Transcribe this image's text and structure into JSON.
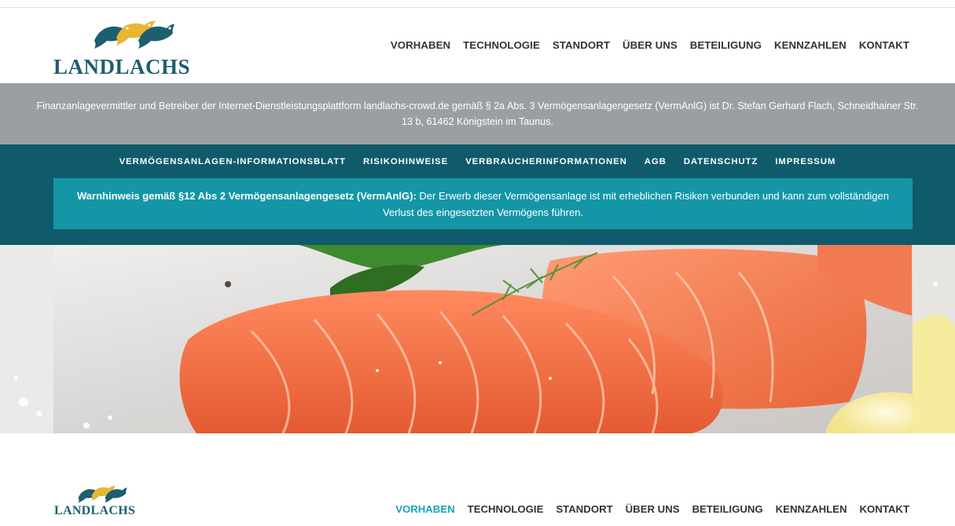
{
  "brand": {
    "name": "LANDLACHS",
    "colors": {
      "primary": "#0f5b6b",
      "accent": "#1496a7",
      "gold": "#e8b634",
      "gray_band": "#9c9fa2",
      "active_nav": "#1aa3b7"
    }
  },
  "nav": {
    "items": [
      "VORHABEN",
      "TECHNOLOGIE",
      "STANDORT",
      "ÜBER UNS",
      "BETEILIGUNG",
      "KENNZAHLEN",
      "KONTAKT"
    ]
  },
  "info_band": {
    "text": "Finanzanlagevermittler und Betreiber der Internet-Dienstleistungsplattform landlachs-crowd.de gemäß § 2a Abs. 3 Vermögensanlagengesetz (VermAnlG) ist Dr. Stefan Gerhard Flach, Schneidhainer Str. 13 b, 61462 Königstein im Taunus."
  },
  "legal_nav": {
    "items": [
      "VERMÖGENSANLAGEN-INFORMATIONSBLATT",
      "RISIKOHINWEISE",
      "VERBRAUCHERINFORMATIONEN",
      "AGB",
      "DATENSCHUTZ",
      "IMPRESSUM"
    ]
  },
  "warning": {
    "title": "Warnhinweis gemäß §12 Abs 2 Vermögensanlagengesetz (VermAnlG):",
    "text": " Der Erwerb dieser Vermögensanlage ist mit erheblichen Risiken verbunden und kann zum vollständigen Verlust des eingesetzten Vermögens führen."
  },
  "hero": {
    "icon": "salmon-fillet-image"
  },
  "sticky_header": {
    "logo_text": "LANDLACHS",
    "nav_items": [
      "VORHABEN",
      "TECHNOLOGIE",
      "STANDORT",
      "ÜBER UNS",
      "BETEILIGUNG",
      "KENNZAHLEN",
      "KONTAKT"
    ],
    "active_item": "VORHABEN"
  }
}
